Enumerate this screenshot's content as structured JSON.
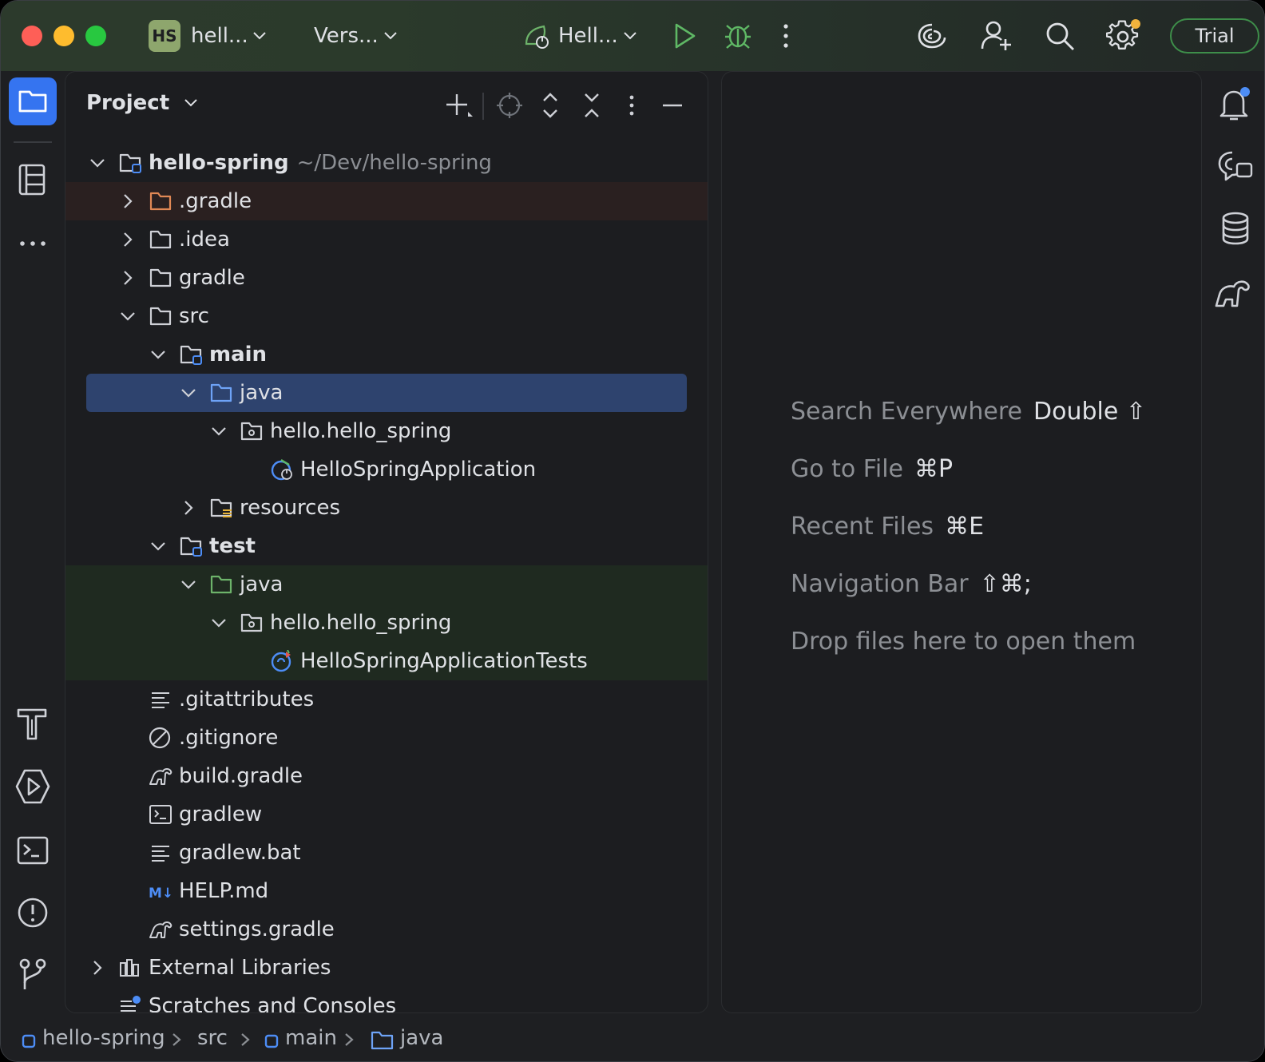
{
  "titlebar": {
    "project_badge": "HS",
    "project_name": "hell...",
    "vcs_label": "Vers...",
    "run_config": "Hell...",
    "trial_label": "Trial"
  },
  "project_panel": {
    "title": "Project",
    "tree": [
      {
        "label": "hello-spring",
        "path": "~/Dev/hello-spring",
        "icon": "module-folder-icon",
        "expanded": true
      },
      {
        "label": ".gradle",
        "icon": "folder-icon-excluded",
        "expanded": false
      },
      {
        "label": ".idea",
        "icon": "folder-icon",
        "expanded": false
      },
      {
        "label": "gradle",
        "icon": "folder-icon",
        "expanded": false
      },
      {
        "label": "src",
        "icon": "folder-icon",
        "expanded": true
      },
      {
        "label": "main",
        "icon": "module-folder-icon",
        "expanded": true
      },
      {
        "label": "java",
        "icon": "source-folder-icon",
        "expanded": true
      },
      {
        "label": "hello.hello_spring",
        "icon": "package-icon",
        "expanded": true
      },
      {
        "label": "HelloSpringApplication",
        "icon": "spring-boot-class-icon"
      },
      {
        "label": "resources",
        "icon": "resources-folder-icon",
        "expanded": false
      },
      {
        "label": "test",
        "icon": "module-folder-icon",
        "expanded": true
      },
      {
        "label": "java",
        "icon": "test-folder-icon",
        "expanded": true
      },
      {
        "label": "hello.hello_spring",
        "icon": "package-icon",
        "expanded": true
      },
      {
        "label": "HelloSpringApplicationTests",
        "icon": "test-class-icon"
      },
      {
        "label": ".gitattributes",
        "icon": "text-file-icon"
      },
      {
        "label": ".gitignore",
        "icon": "ignore-file-icon"
      },
      {
        "label": "build.gradle",
        "icon": "gradle-icon"
      },
      {
        "label": "gradlew",
        "icon": "shell-script-icon"
      },
      {
        "label": "gradlew.bat",
        "icon": "text-file-icon"
      },
      {
        "label": "HELP.md",
        "icon": "markdown-icon"
      },
      {
        "label": "settings.gradle",
        "icon": "gradle-icon"
      },
      {
        "label": "External Libraries",
        "icon": "libraries-icon",
        "expanded": false
      },
      {
        "label": "Scratches and Consoles",
        "icon": "scratches-icon"
      }
    ]
  },
  "editor": {
    "hints": [
      {
        "text": "Search Everywhere",
        "key": "Double ⇧"
      },
      {
        "text": "Go to File",
        "key": "⌘P"
      },
      {
        "text": "Recent Files",
        "key": "⌘E"
      },
      {
        "text": "Navigation Bar",
        "key": "⇧⌘;"
      },
      {
        "text": "Drop files here to open them",
        "key": ""
      }
    ]
  },
  "breadcrumbs": [
    "hello-spring",
    "src",
    "main",
    "java"
  ],
  "colors": {
    "accent": "#3574f0",
    "selection": "#2e436e",
    "run_green": "#5fb865",
    "trial_border": "#3e8e4a",
    "markdown_blue": "#4d8df6"
  }
}
